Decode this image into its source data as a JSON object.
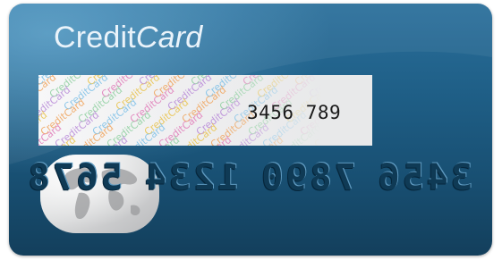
{
  "card": {
    "brand_primary": "Credit",
    "brand_secondary": "Card",
    "number_printed": "3456 789",
    "embossed_groups": [
      "3456",
      "7890",
      "1234",
      "5678"
    ],
    "hologram_text": "CreditCard",
    "colors": {
      "card_top": "#2a6f9b",
      "card_bottom": "#133f5c",
      "brand_text": "#eaf3fa",
      "hologram_bg": "#efeff0"
    },
    "icons": {
      "globe": "globe-icon"
    }
  }
}
